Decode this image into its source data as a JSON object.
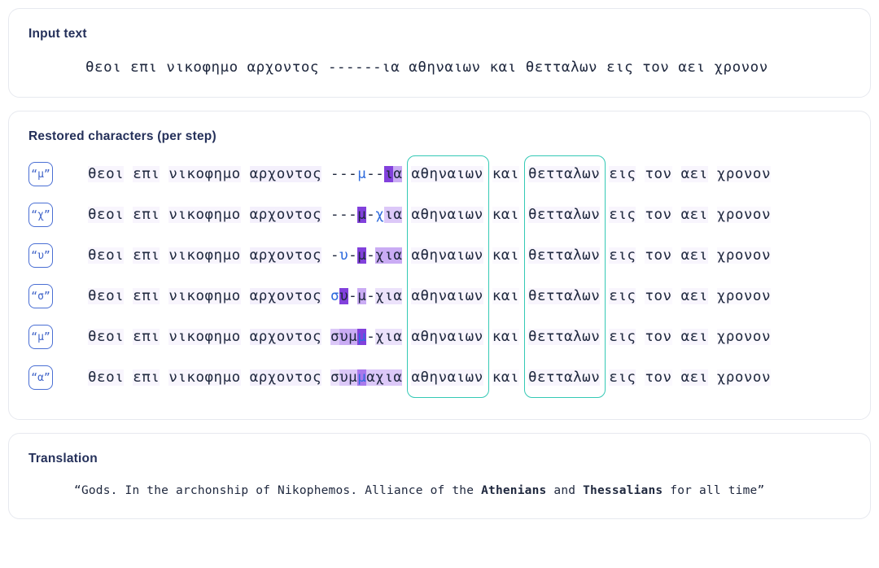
{
  "input_card": {
    "title": "Input text",
    "text": "θεοι επι νικοφημο αρχοντος ------ια αθηναιων και θετταλων εις τον αει χρονον"
  },
  "steps_card": {
    "title": "Restored characters (per step)",
    "prefix": "θεοι επι νικοφημο αρχοντος ",
    "middle": " αθηναιων και θετταλων ",
    "suffix": "εις τον αει χρονον",
    "highlight_words": [
      "αθηναιων",
      "θετταλων"
    ],
    "rows": [
      {
        "badge": "“μ”",
        "predicted_char": "μ",
        "gap": "---μ--ια",
        "gap_cells": [
          {
            "ch": "-",
            "level": 0,
            "new": false
          },
          {
            "ch": "-",
            "level": 0,
            "new": false
          },
          {
            "ch": "-",
            "level": 0,
            "new": false
          },
          {
            "ch": "μ",
            "level": 0,
            "new": true
          },
          {
            "ch": "-",
            "level": 0,
            "new": false
          },
          {
            "ch": "-",
            "level": 0,
            "new": false
          },
          {
            "ch": "ι",
            "level": 5,
            "new": false
          },
          {
            "ch": "α",
            "level": 3,
            "new": false
          }
        ]
      },
      {
        "badge": "“χ”",
        "predicted_char": "χ",
        "gap": "---μ-χια",
        "gap_cells": [
          {
            "ch": "-",
            "level": 0,
            "new": false
          },
          {
            "ch": "-",
            "level": 0,
            "new": false
          },
          {
            "ch": "-",
            "level": 0,
            "new": false
          },
          {
            "ch": "μ",
            "level": 5,
            "new": false
          },
          {
            "ch": "-",
            "level": 0,
            "new": false
          },
          {
            "ch": "χ",
            "level": 0,
            "new": true
          },
          {
            "ch": "ι",
            "level": 2,
            "new": false
          },
          {
            "ch": "α",
            "level": 2,
            "new": false
          }
        ]
      },
      {
        "badge": "“υ”",
        "predicted_char": "υ",
        "gap": "-υ-μ-χια",
        "gap_cells": [
          {
            "ch": "-",
            "level": 0,
            "new": false
          },
          {
            "ch": "υ",
            "level": 0,
            "new": true
          },
          {
            "ch": "-",
            "level": 0,
            "new": false
          },
          {
            "ch": "μ",
            "level": 5,
            "new": false
          },
          {
            "ch": "-",
            "level": 0,
            "new": false
          },
          {
            "ch": "χ",
            "level": 3,
            "new": false
          },
          {
            "ch": "ι",
            "level": 3,
            "new": false
          },
          {
            "ch": "α",
            "level": 3,
            "new": false
          }
        ]
      },
      {
        "badge": "“σ”",
        "predicted_char": "σ",
        "gap": "συ-μ-χια",
        "gap_cells": [
          {
            "ch": "σ",
            "level": 0,
            "new": true
          },
          {
            "ch": "υ",
            "level": 5,
            "new": false
          },
          {
            "ch": "-",
            "level": 0,
            "new": false
          },
          {
            "ch": "μ",
            "level": 3,
            "new": false
          },
          {
            "ch": "-",
            "level": 0,
            "new": false
          },
          {
            "ch": "χ",
            "level": 1,
            "new": false
          },
          {
            "ch": "ι",
            "level": 1,
            "new": false
          },
          {
            "ch": "α",
            "level": 1,
            "new": false
          }
        ]
      },
      {
        "badge": "“μ”",
        "predicted_char": "μ",
        "gap": "συμμ-χια",
        "gap_cells": [
          {
            "ch": "σ",
            "level": 2,
            "new": false
          },
          {
            "ch": "υ",
            "level": 3,
            "new": false
          },
          {
            "ch": "μ",
            "level": 3,
            "new": false
          },
          {
            "ch": "μ",
            "level": 5,
            "new": true
          },
          {
            "ch": "-",
            "level": 0,
            "new": false
          },
          {
            "ch": "χ",
            "level": 1,
            "new": false
          },
          {
            "ch": "ι",
            "level": 1,
            "new": false
          },
          {
            "ch": "α",
            "level": 1,
            "new": false
          }
        ]
      },
      {
        "badge": "“α”",
        "predicted_char": "α",
        "gap": "συμμαχια",
        "gap_cells": [
          {
            "ch": "σ",
            "level": 1,
            "new": false
          },
          {
            "ch": "υ",
            "level": 2,
            "new": false
          },
          {
            "ch": "μ",
            "level": 2,
            "new": false
          },
          {
            "ch": "μ",
            "level": 4,
            "new": true
          },
          {
            "ch": "α",
            "level": 2,
            "new": false
          },
          {
            "ch": "χ",
            "level": 2,
            "new": false
          },
          {
            "ch": "ι",
            "level": 2,
            "new": false
          },
          {
            "ch": "α",
            "level": 2,
            "new": false
          }
        ]
      }
    ],
    "context_tints": {
      "prefix_words": [
        {
          "w": "θεοι",
          "level": 1
        },
        {
          "w": "επι",
          "level": 1
        },
        {
          "w": "νικοφημο",
          "level": 1
        },
        {
          "w": "αρχοντος",
          "level": 2
        }
      ],
      "middle_words": [
        {
          "w": "αθηναιων",
          "level": 1
        },
        {
          "w": "και",
          "level": 0
        },
        {
          "w": "θετταλων",
          "level": 1
        }
      ],
      "suffix_words": [
        {
          "w": "εις",
          "level": 1
        },
        {
          "w": "τον",
          "level": 0
        },
        {
          "w": "αει",
          "level": 1
        },
        {
          "w": "χρονον",
          "level": 0
        }
      ]
    }
  },
  "translation_card": {
    "title": "Translation",
    "open_quote": "“",
    "close_quote": "”",
    "parts": [
      {
        "text": "Gods. In the archonship of Nikophemos. Alliance of the ",
        "bold": false
      },
      {
        "text": "Athenians",
        "bold": true
      },
      {
        "text": " and ",
        "bold": false
      },
      {
        "text": "Thessalians",
        "bold": true
      },
      {
        "text": " for all time",
        "bold": false
      }
    ]
  },
  "colors": {
    "card_border": "#e7e9ef",
    "title": "#24305a",
    "text": "#20293f",
    "new_char": "#2f6bdd",
    "badge_border": "#4a6fd4",
    "teal": "#34c9b5",
    "highlight_purple": "#6d22d6"
  }
}
